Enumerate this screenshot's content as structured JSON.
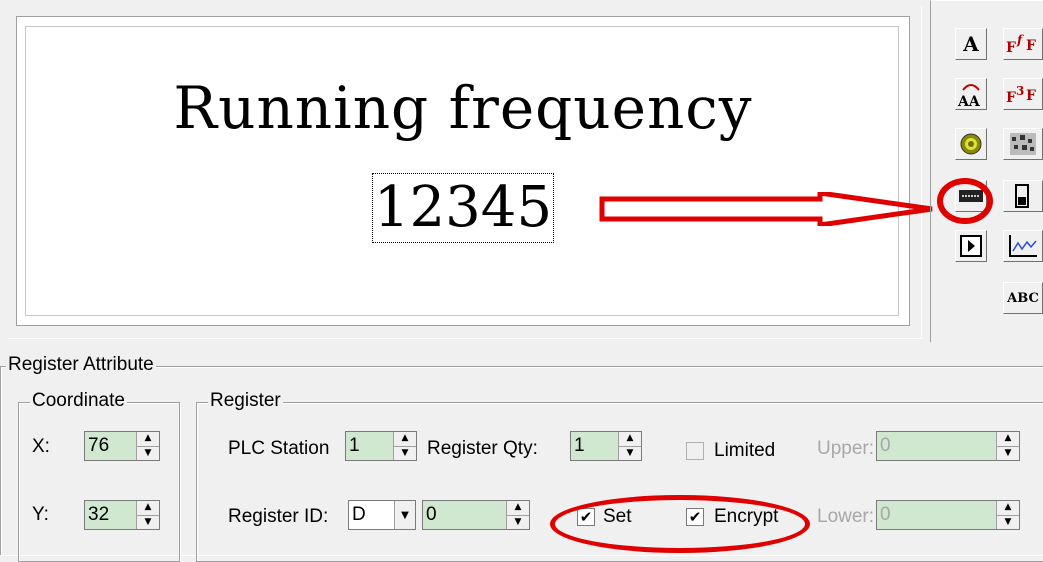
{
  "canvas": {
    "title": "Running frequency",
    "value": "12345"
  },
  "toolbox": {
    "buttons": [
      {
        "name": "text-tool",
        "glyph": "A"
      },
      {
        "name": "font-format-tool",
        "glyph": "FᶠF"
      },
      {
        "name": "text-swap-tool",
        "glyph": "ÀA"
      },
      {
        "name": "font-color-tool",
        "glyph": "F³F"
      },
      {
        "name": "indicator-light-tool",
        "glyph": "◉"
      },
      {
        "name": "pattern-tool",
        "glyph": "░"
      },
      {
        "name": "register-display-tool",
        "glyph": "▬"
      },
      {
        "name": "gauge-tool",
        "glyph": "▌"
      },
      {
        "name": "button-tool",
        "glyph": "▶"
      },
      {
        "name": "trend-chart-tool",
        "glyph": "∿"
      },
      {
        "name": "abc-text-tool",
        "glyph": "ABC"
      }
    ]
  },
  "register_attribute": {
    "title": "Register Attribute",
    "coordinate": {
      "title": "Coordinate",
      "x_label": "X:",
      "x_value": "76",
      "y_label": "Y:",
      "y_value": "32"
    },
    "register": {
      "title": "Register",
      "plc_station_label": "PLC Station",
      "plc_station_value": "1",
      "register_qty_label": "Register Qty:",
      "register_qty_value": "1",
      "limited_label": "Limited",
      "limited_checked": false,
      "upper_label": "Upper:",
      "upper_value": "0",
      "register_id_label": "Register ID:",
      "register_id_type": "D",
      "register_id_value": "0",
      "set_label": "Set",
      "set_checked": true,
      "encrypt_label": "Encrypt",
      "encrypt_checked": true,
      "lower_label": "Lower:",
      "lower_value": "0"
    }
  },
  "colors": {
    "highlight_red": "#e00000",
    "field_green": "#cfe8cf",
    "window_bg": "#f0f0f0"
  }
}
